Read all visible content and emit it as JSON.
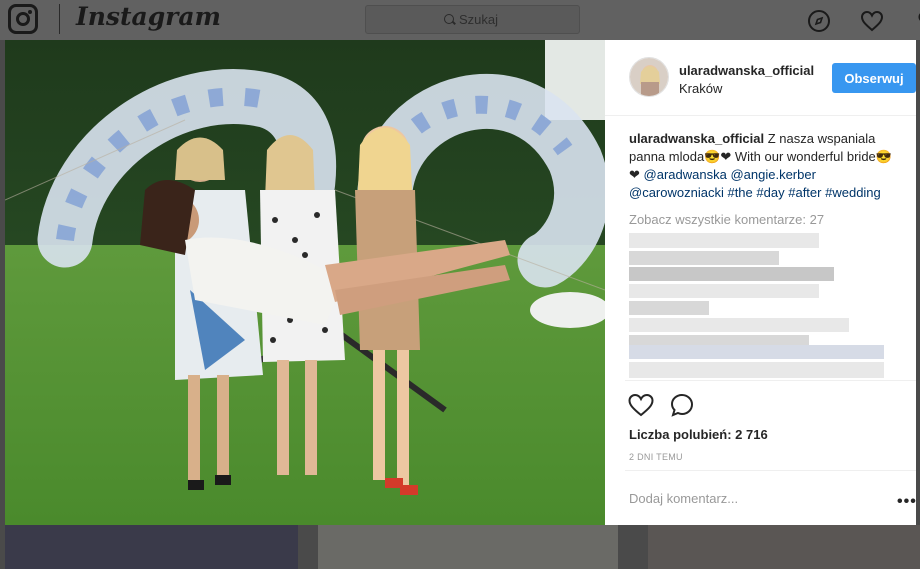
{
  "topbar": {
    "wordmark": "Instagram",
    "search_placeholder": "Szukaj",
    "icons": [
      "instagram-logo-icon",
      "compass-icon",
      "heart-icon",
      "profile-icon"
    ]
  },
  "post": {
    "header": {
      "username": "ularadwanska_official",
      "location": "Kraków",
      "follow_label": "Obserwuj"
    },
    "caption": {
      "username": "ularadwanska_official",
      "text_1": " Z nasza wspaniala panna mloda",
      "emoji_1": "😎❤",
      "text_2": " With our wonderful bride",
      "emoji_2": "😎❤",
      "mention_1": "@aradwanska",
      "mention_2": "@angie.kerber",
      "mention_3": "@carowozniacki",
      "hashtag_1": "#the",
      "hashtag_2": "#day",
      "hashtag_3": "#after",
      "hashtag_4": "#wedding"
    },
    "view_comments": "Zobacz wszystkie komentarze: 27",
    "likes": "Liczba polubień: 2 716",
    "timestamp": "2 DNI TEMU",
    "add_comment_placeholder": "Dodaj komentarz...",
    "more_label": "•••"
  },
  "colors": {
    "accent": "#3897f0",
    "link": "#003569",
    "text": "#262626",
    "muted": "#999999"
  }
}
